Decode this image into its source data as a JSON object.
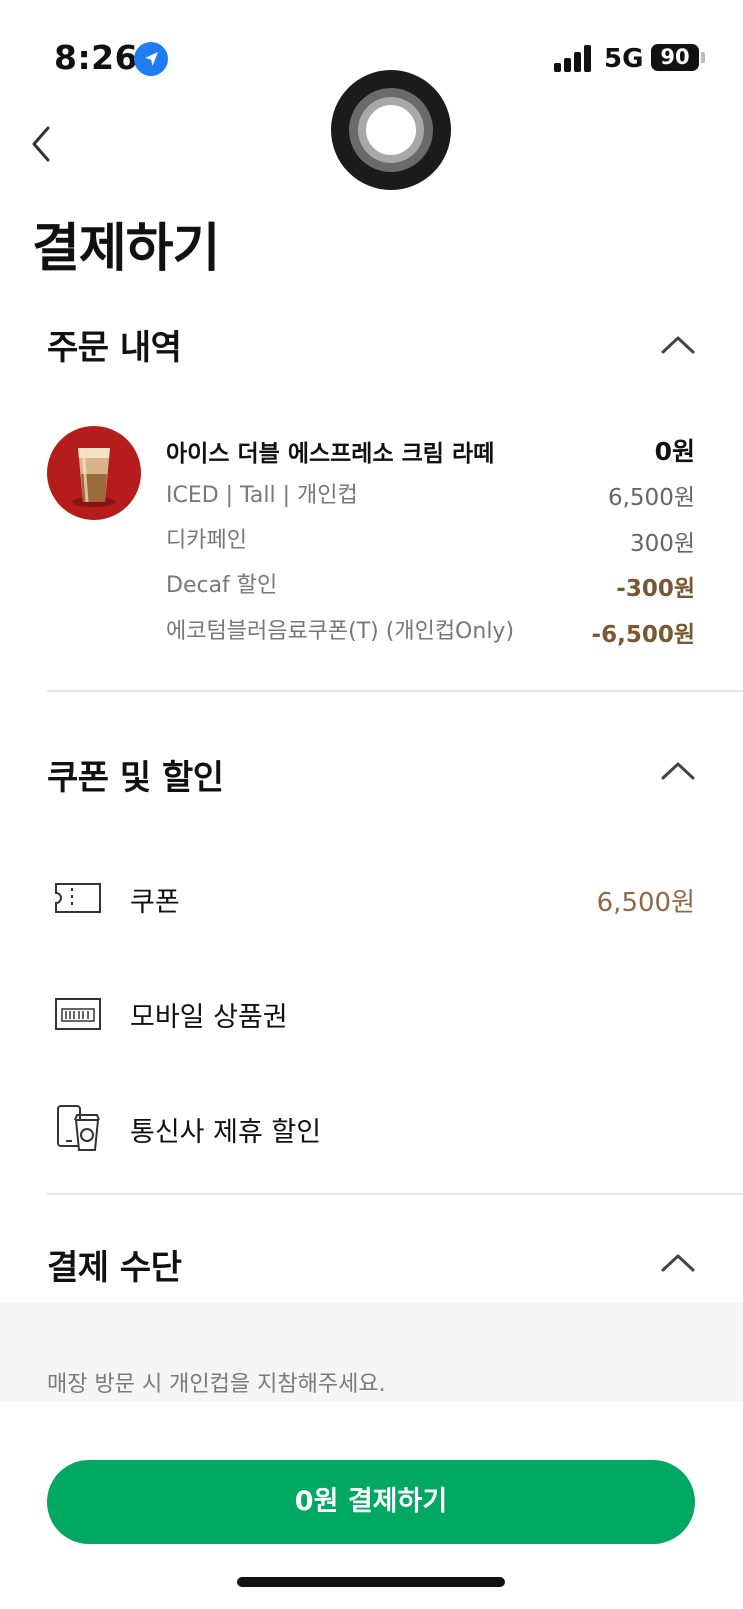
{
  "status_bar": {
    "time": "8:26",
    "network": "5G",
    "battery": "90"
  },
  "header": {
    "title": "결제하기"
  },
  "order": {
    "section_title": "주문 내역",
    "item": {
      "name": "아이스 더블 에스프레소 크림 라떼",
      "price": "0원",
      "options": [
        {
          "label": "ICED | Tall | 개인컵",
          "value": "6,500원",
          "discount": false
        },
        {
          "label": "디카페인",
          "value": "300원",
          "discount": false
        },
        {
          "label": "Decaf 할인",
          "value": "-300원",
          "discount": true
        },
        {
          "label": "에코텀블러음료쿠폰(T) (개인컵Only)",
          "value": "-6,500원",
          "discount": true
        }
      ]
    }
  },
  "coupons": {
    "section_title": "쿠폰 및 할인",
    "rows": [
      {
        "label": "쿠폰",
        "value": "6,500원",
        "icon": "ticket-icon"
      },
      {
        "label": "모바일 상품권",
        "value": "",
        "icon": "gift-card-icon"
      },
      {
        "label": "통신사 제휴 할인",
        "value": "",
        "icon": "phone-cup-icon"
      }
    ]
  },
  "payment": {
    "section_title": "결제 수단"
  },
  "notice": "매장 방문 시 개인컵을 지참해주세요.",
  "pay_button": "0원 결제하기",
  "colors": {
    "accent": "#00a862",
    "discount": "#7a5733",
    "coupon_value": "#8b6a45"
  }
}
